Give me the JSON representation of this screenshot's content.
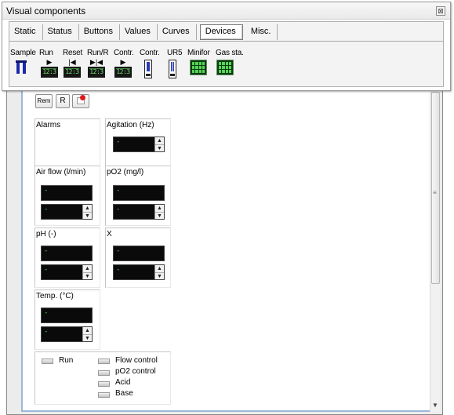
{
  "palette": {
    "title": "Visual components",
    "close_glyph": "⊠",
    "tabs": [
      {
        "label": "Static",
        "selected": false
      },
      {
        "label": "Status",
        "selected": false
      },
      {
        "label": "Buttons",
        "selected": false
      },
      {
        "label": "Values",
        "selected": false
      },
      {
        "label": "Curves",
        "selected": false
      },
      {
        "label": "Devices",
        "selected": true
      },
      {
        "label": "Misc.",
        "selected": false
      }
    ],
    "components": [
      {
        "label": "Sample",
        "icon": "sample-icon"
      },
      {
        "label": "Run",
        "icon": "run-icon"
      },
      {
        "label": "Reset",
        "icon": "reset-icon"
      },
      {
        "label": "Run/R",
        "icon": "run-reset-icon"
      },
      {
        "label": "Contr.",
        "icon": "controller-icon"
      },
      {
        "label": "Contr.",
        "icon": "controller-bar-icon"
      },
      {
        "label": "UR5",
        "icon": "ur5-icon"
      },
      {
        "label": "Minifor",
        "icon": "minifor-icon"
      },
      {
        "label": "Gas sta.",
        "icon": "gas-station-icon"
      }
    ],
    "lcd_icon_text": "12:3"
  },
  "main": {
    "toolbar": {
      "rem_label": "Rem",
      "r_label": "R",
      "record_icon": "record-icon"
    },
    "panels": {
      "alarms": {
        "label": "Alarms"
      },
      "agitation": {
        "label": "Agitation (Hz)",
        "setpoint": "-"
      },
      "air_flow": {
        "label": "Air flow (l/min)",
        "value": "-",
        "setpoint": "-"
      },
      "po2": {
        "label": "pO2 (mg/l)",
        "value": "-",
        "setpoint": "-"
      },
      "ph": {
        "label": "pH (-)",
        "value": "-",
        "setpoint": "-"
      },
      "x": {
        "label": "X",
        "value": "-",
        "setpoint": "-"
      },
      "temp": {
        "label": "Temp. (°C)",
        "value": "-",
        "setpoint": "-"
      }
    },
    "status": {
      "run": "Run",
      "flow_control": "Flow control",
      "po2_control": "pO2 control",
      "acid": "Acid",
      "base": "Base"
    },
    "scrollbar_grip": "≡",
    "scroll_down_glyph": "▼"
  },
  "colors": {
    "lcd_background": "#0a0a0a",
    "lcd_text": "#5dd35d",
    "window_border": "#9bb7d8"
  }
}
